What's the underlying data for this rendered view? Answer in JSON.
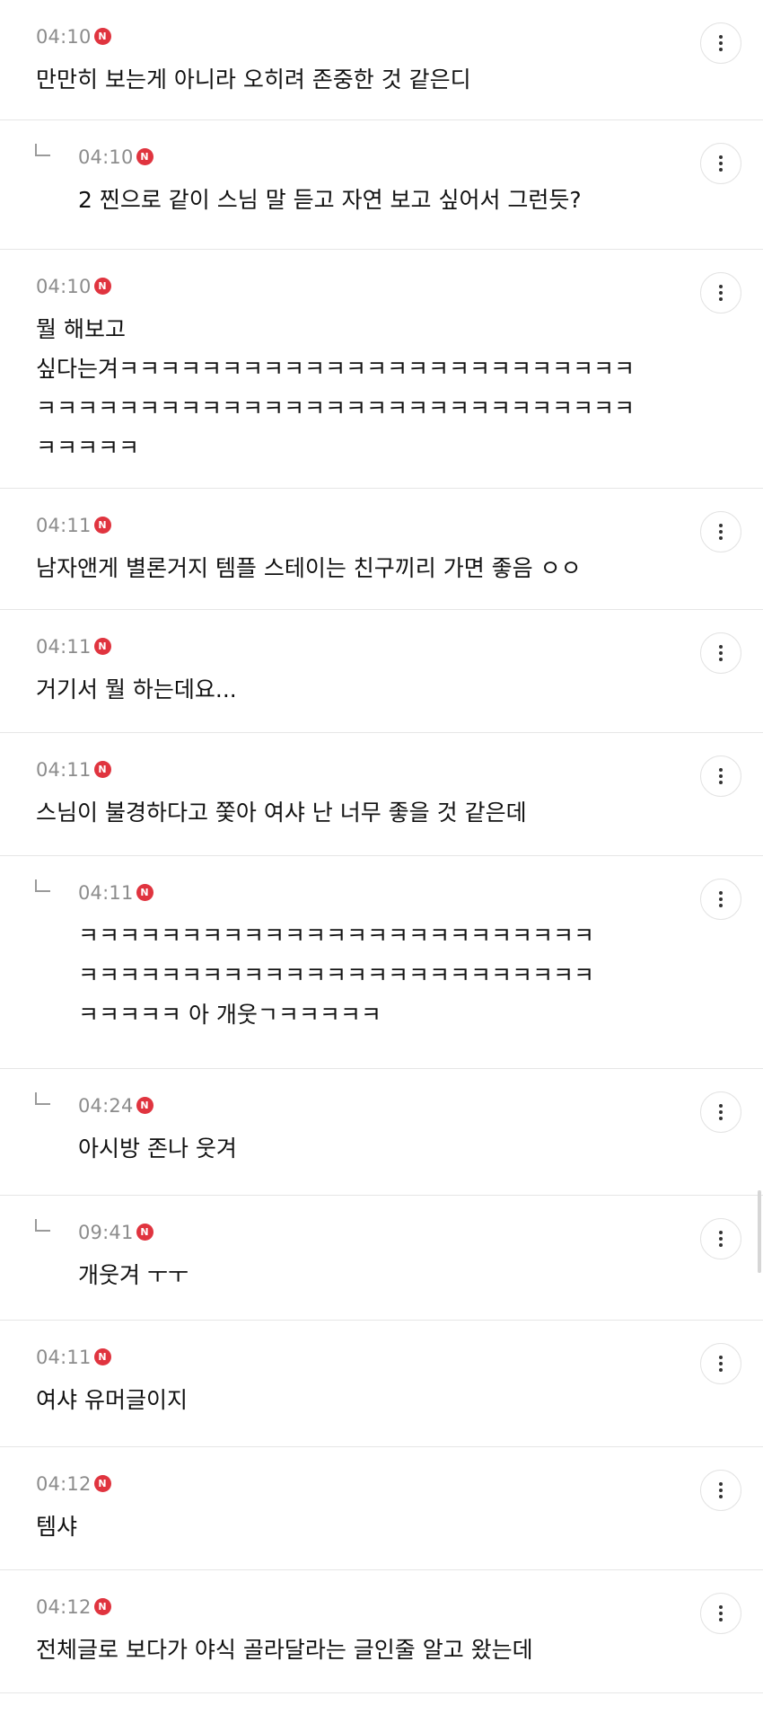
{
  "comments": [
    {
      "time": "04:10",
      "badge": "N",
      "text": "만만히 보는게 아니라 오히려 존중한 것 같은디",
      "reply": false
    },
    {
      "time": "04:10",
      "badge": "N",
      "text": "2 찐으로 같이 스님 말 듣고 자연 보고 싶어서 그런듯?",
      "reply": true
    },
    {
      "time": "04:10",
      "badge": "N",
      "text": "뭘 해보고\n싶다는겨ㅋㅋㅋㅋㅋㅋㅋㅋㅋㅋㅋㅋㅋㅋㅋㅋㅋㅋㅋㅋㅋㅋㅋㅋㅋ\nㅋㅋㅋㅋㅋㅋㅋㅋㅋㅋㅋㅋㅋㅋㅋㅋㅋㅋㅋㅋㅋㅋㅋㅋㅋㅋㅋㅋㅋ\nㅋㅋㅋㅋㅋ",
      "reply": false
    },
    {
      "time": "04:11",
      "badge": "N",
      "text": "남자앤게 별론거지 템플 스테이는 친구끼리 가면 좋음 ㅇㅇ",
      "reply": false
    },
    {
      "time": "04:11",
      "badge": "N",
      "text": "거기서 뭘 하는데요...",
      "reply": false
    },
    {
      "time": "04:11",
      "badge": "N",
      "text": "스님이 불경하다고 쫓아 여샤 난 너무 좋을 것 같은데",
      "reply": false
    },
    {
      "time": "04:11",
      "badge": "N",
      "text": "ㅋㅋㅋㅋㅋㅋㅋㅋㅋㅋㅋㅋㅋㅋㅋㅋㅋㅋㅋㅋㅋㅋㅋㅋㅋ\nㅋㅋㅋㅋㅋㅋㅋㅋㅋㅋㅋㅋㅋㅋㅋㅋㅋㅋㅋㅋㅋㅋㅋㅋㅋ\nㅋㅋㅋㅋㅋ 아 개웃ㄱㅋㅋㅋㅋㅋ",
      "reply": true
    },
    {
      "time": "04:24",
      "badge": "N",
      "text": "아시방 존나 웃겨",
      "reply": true
    },
    {
      "time": "09:41",
      "badge": "N",
      "text": "개웃겨 ㅜㅜ",
      "reply": true
    },
    {
      "time": "04:11",
      "badge": "N",
      "text": "여샤 유머글이지",
      "reply": false
    },
    {
      "time": "04:12",
      "badge": "N",
      "text": "템샤",
      "reply": false
    },
    {
      "time": "04:12",
      "badge": "N",
      "text": "전체글로 보다가 야식 골라달라는 글인줄 알고 왔는데",
      "reply": false
    }
  ],
  "icons": {
    "more": "more-vertical-icon",
    "reply": "reply-arrow-icon",
    "new": "new-badge"
  },
  "colors": {
    "badge": "#e0343f",
    "time": "#8c8c8c",
    "text": "#111111",
    "divider": "#e6e6e6"
  }
}
